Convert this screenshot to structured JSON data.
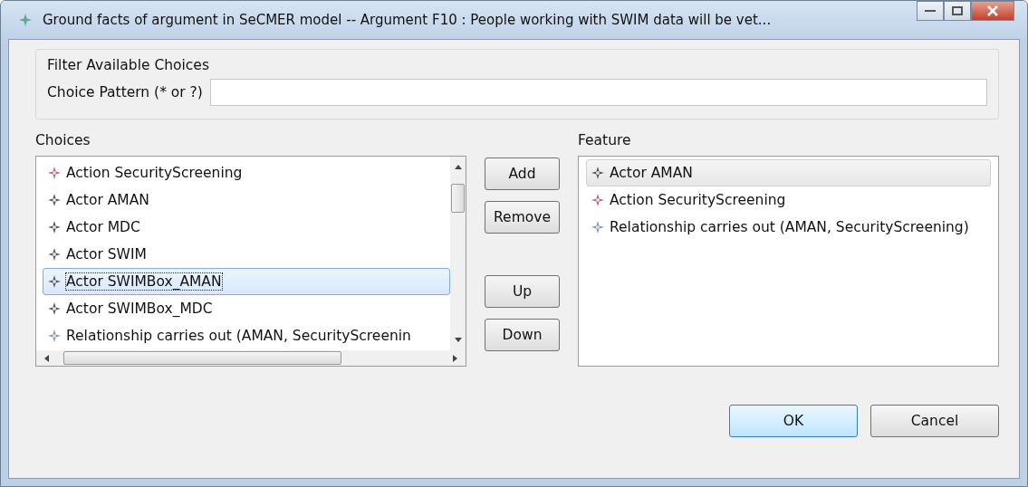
{
  "window": {
    "title": "Ground facts of argument in SeCMER model -- Argument F10 : People working with SWIM data will be vet..."
  },
  "filter": {
    "group_title": "Filter Available Choices",
    "label": "Choice Pattern (* or ?)"
  },
  "choices": {
    "label": "Choices",
    "items": [
      {
        "kind": "action",
        "text": "Action SecurityScreening",
        "selected": false
      },
      {
        "kind": "actor",
        "text": "Actor AMAN",
        "selected": false
      },
      {
        "kind": "actor",
        "text": "Actor MDC",
        "selected": false
      },
      {
        "kind": "actor",
        "text": "Actor SWIM",
        "selected": false
      },
      {
        "kind": "actor",
        "text": "Actor SWIMBox_AMAN",
        "selected": true
      },
      {
        "kind": "actor",
        "text": "Actor SWIMBox_MDC",
        "selected": false
      },
      {
        "kind": "relationship",
        "text": "Relationship carries out (AMAN, SecurityScreenin",
        "selected": false
      }
    ]
  },
  "side_buttons": [
    {
      "label": "Add"
    },
    {
      "label": "Remove"
    },
    {
      "label": "Up"
    },
    {
      "label": "Down"
    }
  ],
  "feature": {
    "label": "Feature",
    "items": [
      {
        "kind": "actor",
        "text": "Actor AMAN",
        "selected": true
      },
      {
        "kind": "action",
        "text": "Action SecurityScreening",
        "selected": false
      },
      {
        "kind": "relationship",
        "text": "Relationship carries out (AMAN, SecurityScreening)",
        "selected": false
      }
    ]
  },
  "buttons": [
    {
      "label": "OK",
      "default": true
    },
    {
      "label": "Cancel",
      "default": false
    }
  ]
}
